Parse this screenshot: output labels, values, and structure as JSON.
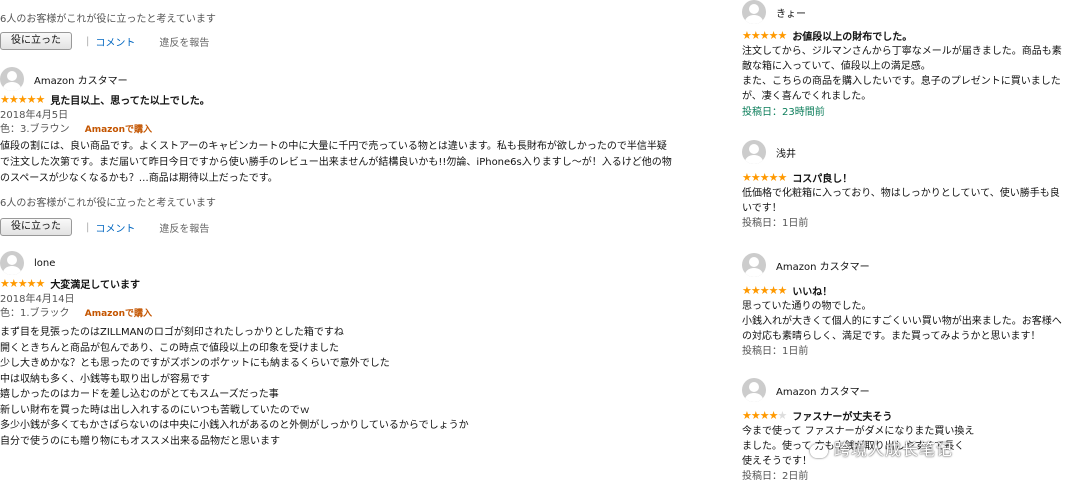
{
  "left": {
    "top_helpful": "6人のお客様がこれが役に立ったと考えています",
    "actions": {
      "helpful_btn": "役に立った",
      "comment": "コメント",
      "report": "違反を報告"
    },
    "reviews": [
      {
        "name": "Amazon カスタマー",
        "stars": "★★★★★",
        "title": "見た目以上、思ってた以上でした。",
        "date": "2018年4月5日",
        "variant": "色：3.ブラウン",
        "verified": "Amazonで購入",
        "body": [
          "値段の割には、良い商品です。よくストアーのキャビンカートの中に大量に千円で売っている物とは違います。私も長財布が欲しかったので半信半疑",
          "で注文した次第です。まだ届いて昨日今日ですから使い勝手のレビュー出来ませんが結構良いかも!!勿論、iPhone6s入りますし〜が！入るけど他の物",
          "のスペースが少なくなるかも？…商品は期待以上だったです。"
        ],
        "helpful": "6人のお客様がこれが役に立ったと考えています"
      },
      {
        "name": "lone",
        "stars": "★★★★★",
        "title": "大変満足しています",
        "date": "2018年4月14日",
        "variant": "色：1.ブラック",
        "verified": "Amazonで購入",
        "body": [
          "まず目を見張ったのはZILLMANのロゴが刻印されたしっかりとした箱ですね",
          "開くときちんと商品が包んであり、この時点で値段以上の印象を受けました",
          "少し大きめかな？とも思ったのですがズボンのポケットにも納まるくらいで意外でした",
          "中は収納も多く、小銭等も取り出しが容易です",
          "嬉しかったのはカードを差し込むのがとてもスムーズだった事",
          "新しい財布を買った時は出し入れするのにいつも苦戦していたのでｗ",
          "多少小銭が多くてもかさばらないのは中央に小銭入れがあるのと外側がしっかりしているからでしょうか",
          "自分で使うのにも贈り物にもオススメ出来る品物だと思います"
        ]
      }
    ]
  },
  "right": {
    "reviews": [
      {
        "name": "きょー",
        "stars_on": "★★★★★",
        "stars_off": "",
        "title": "お値段以上の財布でした。",
        "body": [
          "注文してから、ジルマンさんから丁寧なメールが届きました。商品も素",
          "敵な箱に入っていて、値段以上の満足感。",
          "また、こちらの商品を購入したいです。息子のプレゼントに買いました",
          "が、凄く喜んでくれました。"
        ],
        "posted_label": "投稿日：",
        "posted_value": "23時間前"
      },
      {
        "name": "浅井",
        "stars_on": "★★★★★",
        "stars_off": "",
        "title": "コスパ良し！",
        "body": [
          "低価格で化粧箱に入っており、物はしっかりとしていて、使い勝手も良",
          "いです！"
        ],
        "posted_label": "投稿日：",
        "posted_value": "1日前"
      },
      {
        "name": "Amazon カスタマー",
        "stars_on": "★★★★★",
        "stars_off": "",
        "title": "いいね！",
        "body": [
          "思っていた通りの物でした。",
          "小銭入れが大きくて個人的にすごくいい買い物が出来ました。お客様へ",
          "の対応も素晴らしく、満足です。また買ってみようかと思います！"
        ],
        "posted_label": "投稿日：",
        "posted_value": "1日前"
      },
      {
        "name": "Amazon カスタマー",
        "stars_on": "★★★★",
        "stars_off": "★",
        "title": "ファスナーが丈夫そう",
        "body": [
          "今まで使って       ファスナーがダメになりまた買い換え",
          "ました。使って       方も小銭が取り出しやすくて長く",
          "使えそうです！"
        ],
        "posted_label": "投稿日：",
        "posted_value": "2日前"
      }
    ]
  },
  "watermark": "跨境人成长笔记"
}
